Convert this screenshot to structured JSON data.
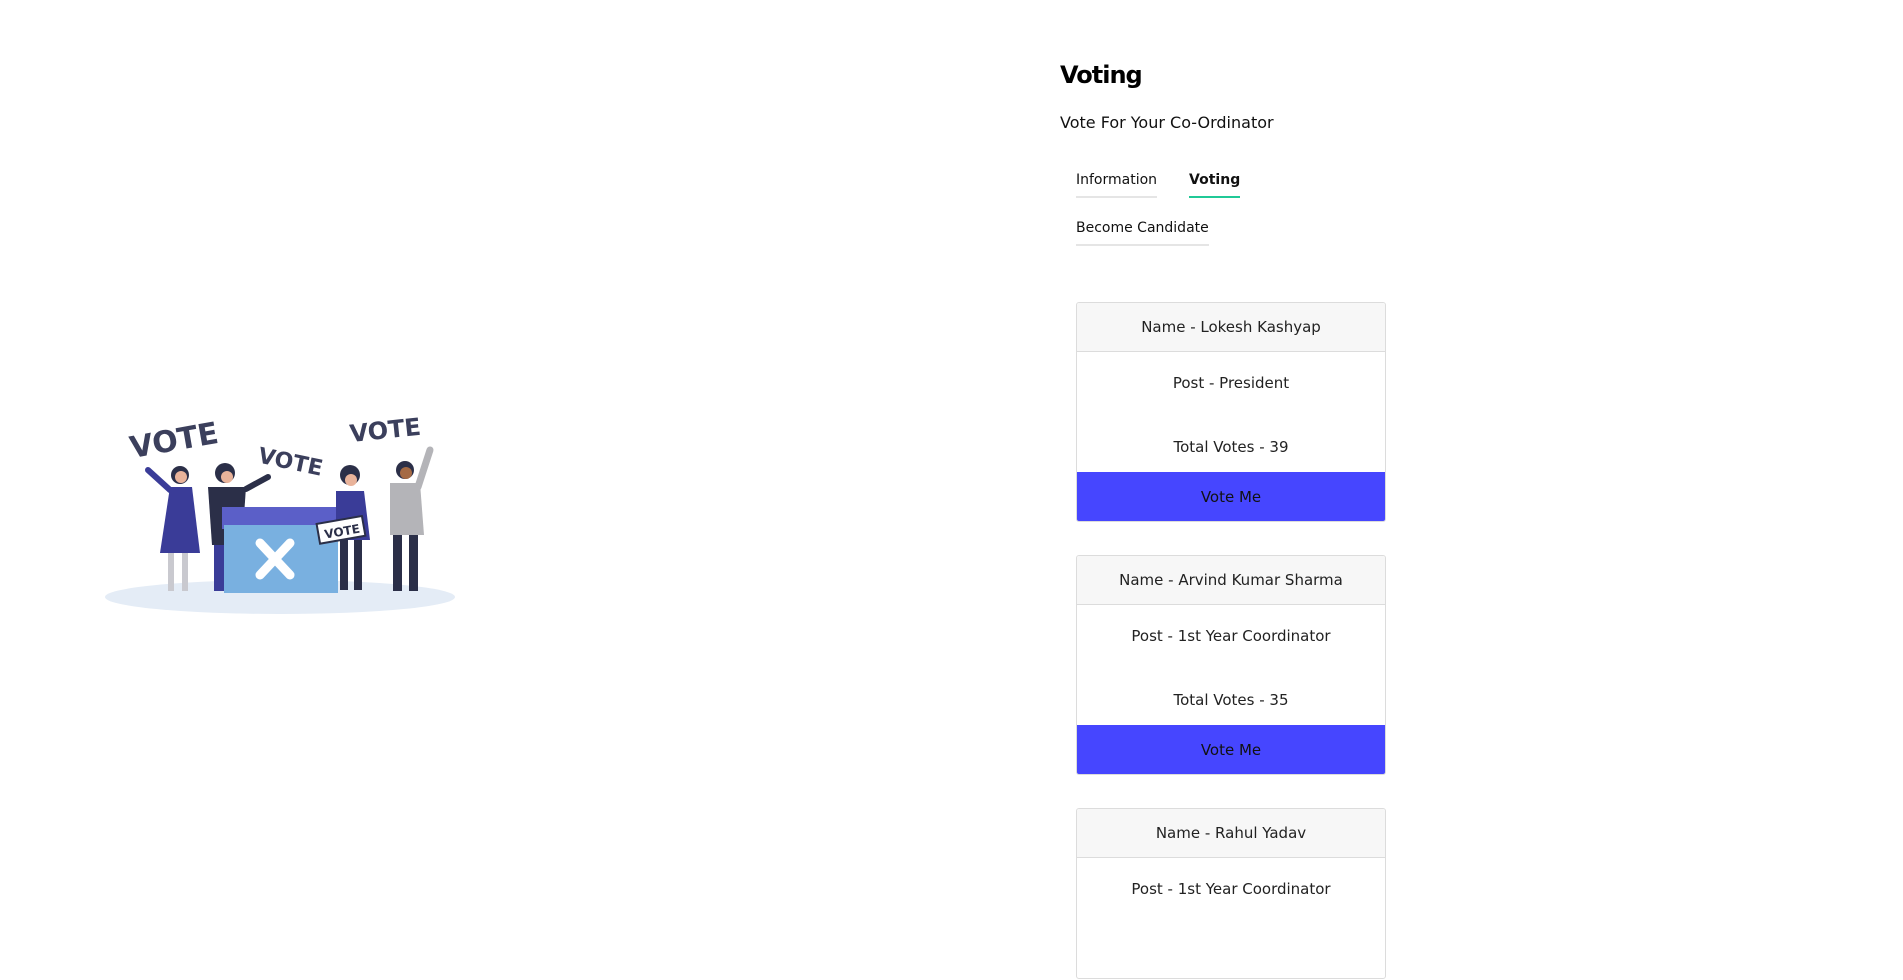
{
  "header": {
    "title": "Voting",
    "subtitle": "Vote For Your Co-Ordinator"
  },
  "tabs": [
    {
      "label": "Information",
      "active": false
    },
    {
      "label": "Voting",
      "active": true
    },
    {
      "label": "Become Candidate",
      "active": false
    }
  ],
  "illustration": {
    "sign_text": "VOTE",
    "icon": "ballot-box-x-icon"
  },
  "candidates": [
    {
      "name": "Name - Lokesh Kashyap",
      "post": "Post - President",
      "votes": "Total Votes - 39",
      "button": "Vote Me"
    },
    {
      "name": "Name - Arvind Kumar Sharma",
      "post": "Post - 1st Year Coordinator",
      "votes": "Total Votes - 35",
      "button": "Vote Me"
    },
    {
      "name": "Name - Rahul Yadav",
      "post": "Post - 1st Year Coordinator",
      "votes": "",
      "button": ""
    }
  ],
  "colors": {
    "accent": "#4646ff",
    "active_tab": "#20c997"
  }
}
